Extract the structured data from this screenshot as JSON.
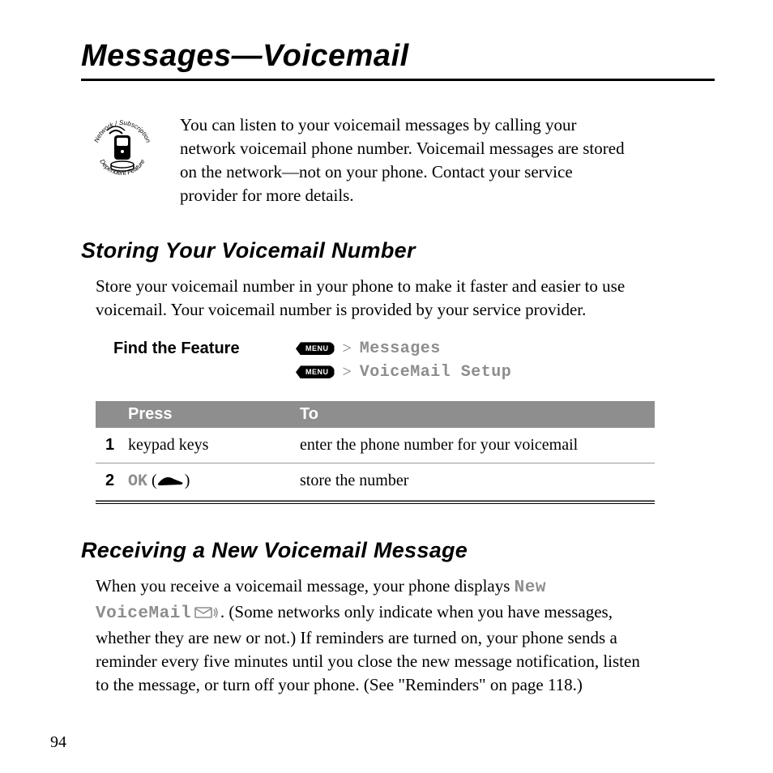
{
  "title": "Messages—Voicemail",
  "intro": "You can listen to your voicemail messages by calling your network voicemail phone number. Voicemail messages are stored on the network—not on your phone. Contact your service provider for more details.",
  "icon_label": "Network / Subscription Dependent Feature",
  "section1": {
    "heading": "Storing Your Voicemail Number",
    "body": "Store your voicemail number in your phone to make it faster and easier to use voicemail. Your voicemail number is provided by your service provider.",
    "find_label": "Find the Feature",
    "menu_key": "MENU",
    "gt": ">",
    "path1": "Messages",
    "path2": "VoiceMail Setup",
    "table": {
      "head_press": "Press",
      "head_to": "To",
      "rows": [
        {
          "n": "1",
          "press": "keypad keys",
          "to": "enter the phone number for your voicemail"
        },
        {
          "n": "2",
          "press_ok": "OK",
          "press_paren_open": "(",
          "press_paren_close": ")",
          "to": "store the number"
        }
      ]
    }
  },
  "section2": {
    "heading": "Receiving a New Voicemail Message",
    "body_pre": "When you receive a voicemail message, your phone displays ",
    "new_voicemail": "New VoiceMail",
    "body_post": ". (Some networks only indicate when you have messages, whether they are new or not.) If reminders are turned on, your phone sends a reminder every five minutes until you close the new message notification, listen to the message, or turn off your phone. (See \"Reminders\" on page 118.)"
  },
  "page_number": "94"
}
